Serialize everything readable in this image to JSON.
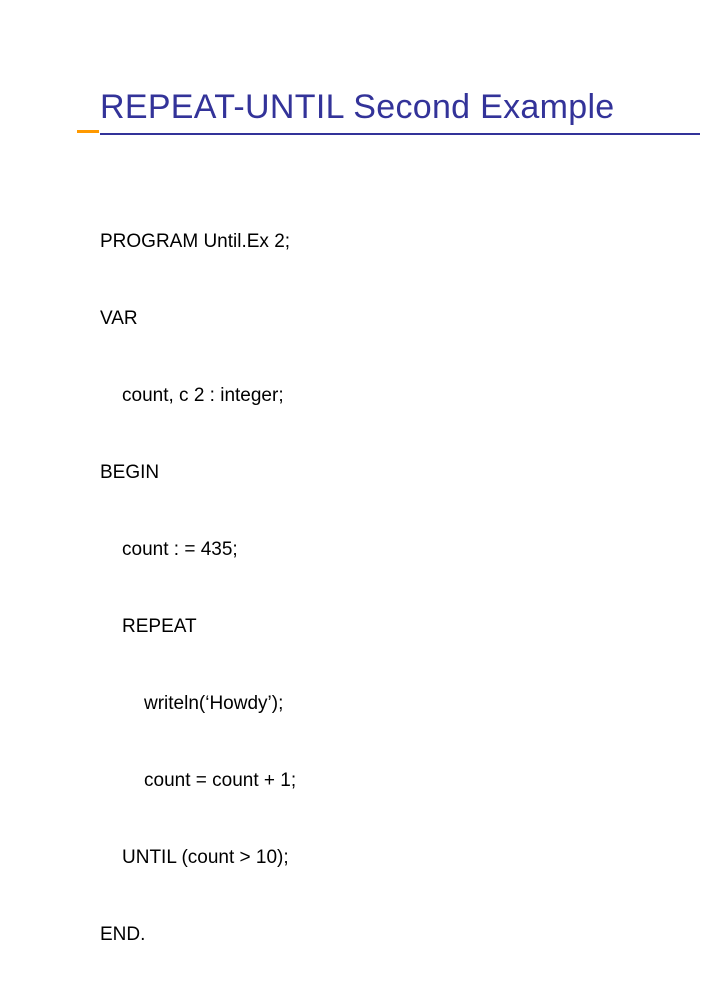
{
  "title": "REPEAT-UNTIL Second Example",
  "code": {
    "l1": "PROGRAM Until.Ex 2;",
    "l2": "VAR",
    "l3": "count, c 2 : integer;",
    "l4": "BEGIN",
    "l5": "count : = 435;",
    "l6": "REPEAT",
    "l7": "writeln(‘Howdy’);",
    "l8": "count = count + 1;",
    "l9": "UNTIL (count > 10);",
    "l10": "END."
  }
}
